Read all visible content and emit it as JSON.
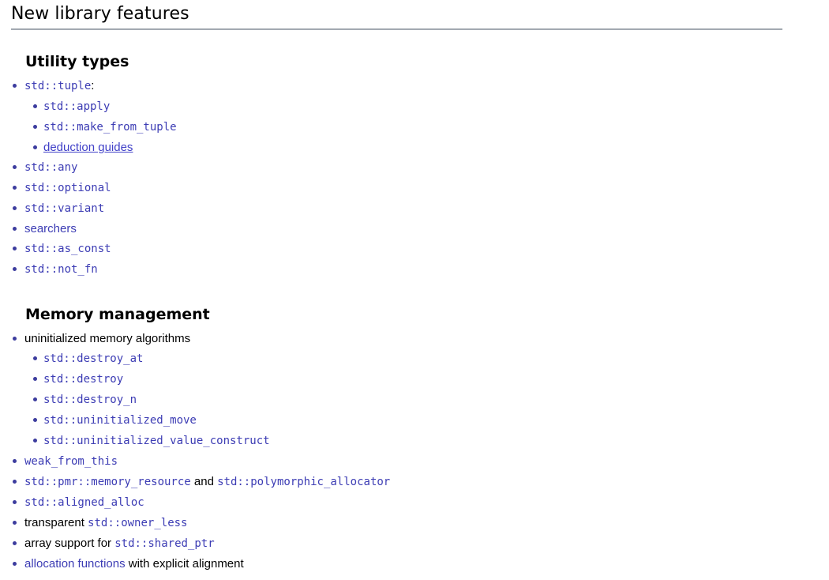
{
  "header": {
    "title": "New library features"
  },
  "sections": [
    {
      "id": "utility-types",
      "heading": "Utility types",
      "items": [
        {
          "runs": [
            {
              "text": "std::tuple",
              "style": "code-link"
            },
            {
              "text": ":",
              "style": "plain"
            }
          ],
          "children": [
            {
              "runs": [
                {
                  "text": "std::apply",
                  "style": "code-link"
                }
              ]
            },
            {
              "runs": [
                {
                  "text": "std::make_from_tuple",
                  "style": "code-link"
                }
              ]
            },
            {
              "runs": [
                {
                  "text": "deduction guides",
                  "style": "text-link-visited"
                }
              ]
            }
          ]
        },
        {
          "runs": [
            {
              "text": "std::any",
              "style": "code-link"
            }
          ],
          "children": []
        },
        {
          "runs": [
            {
              "text": "std::optional",
              "style": "code-link"
            }
          ],
          "children": []
        },
        {
          "runs": [
            {
              "text": "std::variant",
              "style": "code-link"
            }
          ],
          "children": []
        },
        {
          "runs": [
            {
              "text": "searchers",
              "style": "text-link"
            }
          ],
          "children": []
        },
        {
          "runs": [
            {
              "text": "std::as_const",
              "style": "code-link"
            }
          ],
          "children": []
        },
        {
          "runs": [
            {
              "text": "std::not_fn",
              "style": "code-link"
            }
          ],
          "children": []
        }
      ]
    },
    {
      "id": "memory-management",
      "heading": "Memory management",
      "items": [
        {
          "runs": [
            {
              "text": "uninitialized memory algorithms",
              "style": "plain"
            }
          ],
          "children": [
            {
              "runs": [
                {
                  "text": "std::destroy_at",
                  "style": "code-link"
                }
              ]
            },
            {
              "runs": [
                {
                  "text": "std::destroy",
                  "style": "code-link"
                }
              ]
            },
            {
              "runs": [
                {
                  "text": "std::destroy_n",
                  "style": "code-link"
                }
              ]
            },
            {
              "runs": [
                {
                  "text": "std::uninitialized_move",
                  "style": "code-link"
                }
              ]
            },
            {
              "runs": [
                {
                  "text": "std::uninitialized_value_construct",
                  "style": "code-link"
                }
              ]
            }
          ]
        },
        {
          "runs": [
            {
              "text": "weak_from_this",
              "style": "code-link"
            }
          ],
          "children": []
        },
        {
          "runs": [
            {
              "text": "std::pmr::memory_resource",
              "style": "code-link"
            },
            {
              "text": " and ",
              "style": "plain"
            },
            {
              "text": "std::polymorphic_allocator",
              "style": "code-link"
            }
          ],
          "children": []
        },
        {
          "runs": [
            {
              "text": "std::aligned_alloc",
              "style": "code-link"
            }
          ],
          "children": []
        },
        {
          "runs": [
            {
              "text": "transparent ",
              "style": "plain"
            },
            {
              "text": "std::owner_less",
              "style": "code-link"
            }
          ],
          "children": []
        },
        {
          "runs": [
            {
              "text": "array support for ",
              "style": "plain"
            },
            {
              "text": "std::shared_ptr",
              "style": "code-link"
            }
          ],
          "children": []
        },
        {
          "runs": [
            {
              "text": "allocation functions",
              "style": "text-link"
            },
            {
              "text": " with explicit alignment",
              "style": "plain"
            }
          ],
          "children": []
        }
      ]
    }
  ],
  "colors": {
    "link": "#3c3cb4",
    "visited_link": "#4040c8",
    "bullet": "#3c3c9e",
    "rule": "#a2a9b1",
    "text": "#000000",
    "background": "#ffffff"
  }
}
